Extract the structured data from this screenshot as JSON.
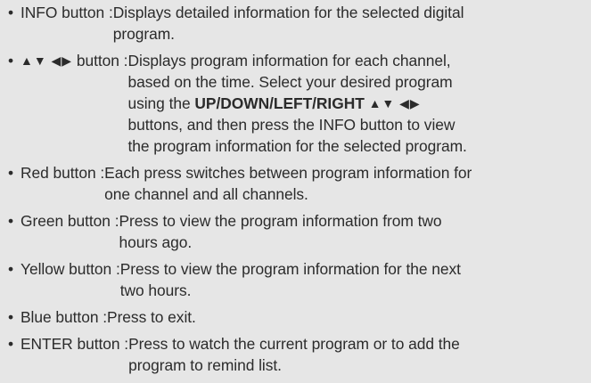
{
  "bullet": "•",
  "items": [
    {
      "term": "INFO button : ",
      "lines": [
        "Displays detailed information for the selected digital",
        "program."
      ]
    },
    {
      "term_arrows_1": "▲▼",
      "term_arrows_2": "◀▶",
      "term": " button : ",
      "lines": [
        "Displays program information for each channel,",
        "based on the time. Select your desired program"
      ],
      "line3_prefix": "using the ",
      "line3_bold": "UP/DOWN/LEFT/RIGHT",
      "line3_arrows_1": "▲▼",
      "line3_arrows_2": "◀▶",
      "lines_rest": [
        "buttons, and then press the INFO button to view",
        "the program information for the selected program."
      ]
    },
    {
      "term": "Red button : ",
      "lines": [
        "Each press switches between program information for",
        "one channel   and all channels."
      ]
    },
    {
      "term": "Green button : ",
      "lines": [
        "Press to view the program information from two",
        "hours ago."
      ]
    },
    {
      "term": "Yellow button : ",
      "lines": [
        "Press to view the program information for the next",
        "two hours."
      ]
    },
    {
      "term": "Blue button : ",
      "lines": [
        "Press to exit."
      ]
    },
    {
      "term": "ENTER button : ",
      "lines": [
        "Press to watch the current program or to add the",
        "program to remind list."
      ]
    }
  ]
}
